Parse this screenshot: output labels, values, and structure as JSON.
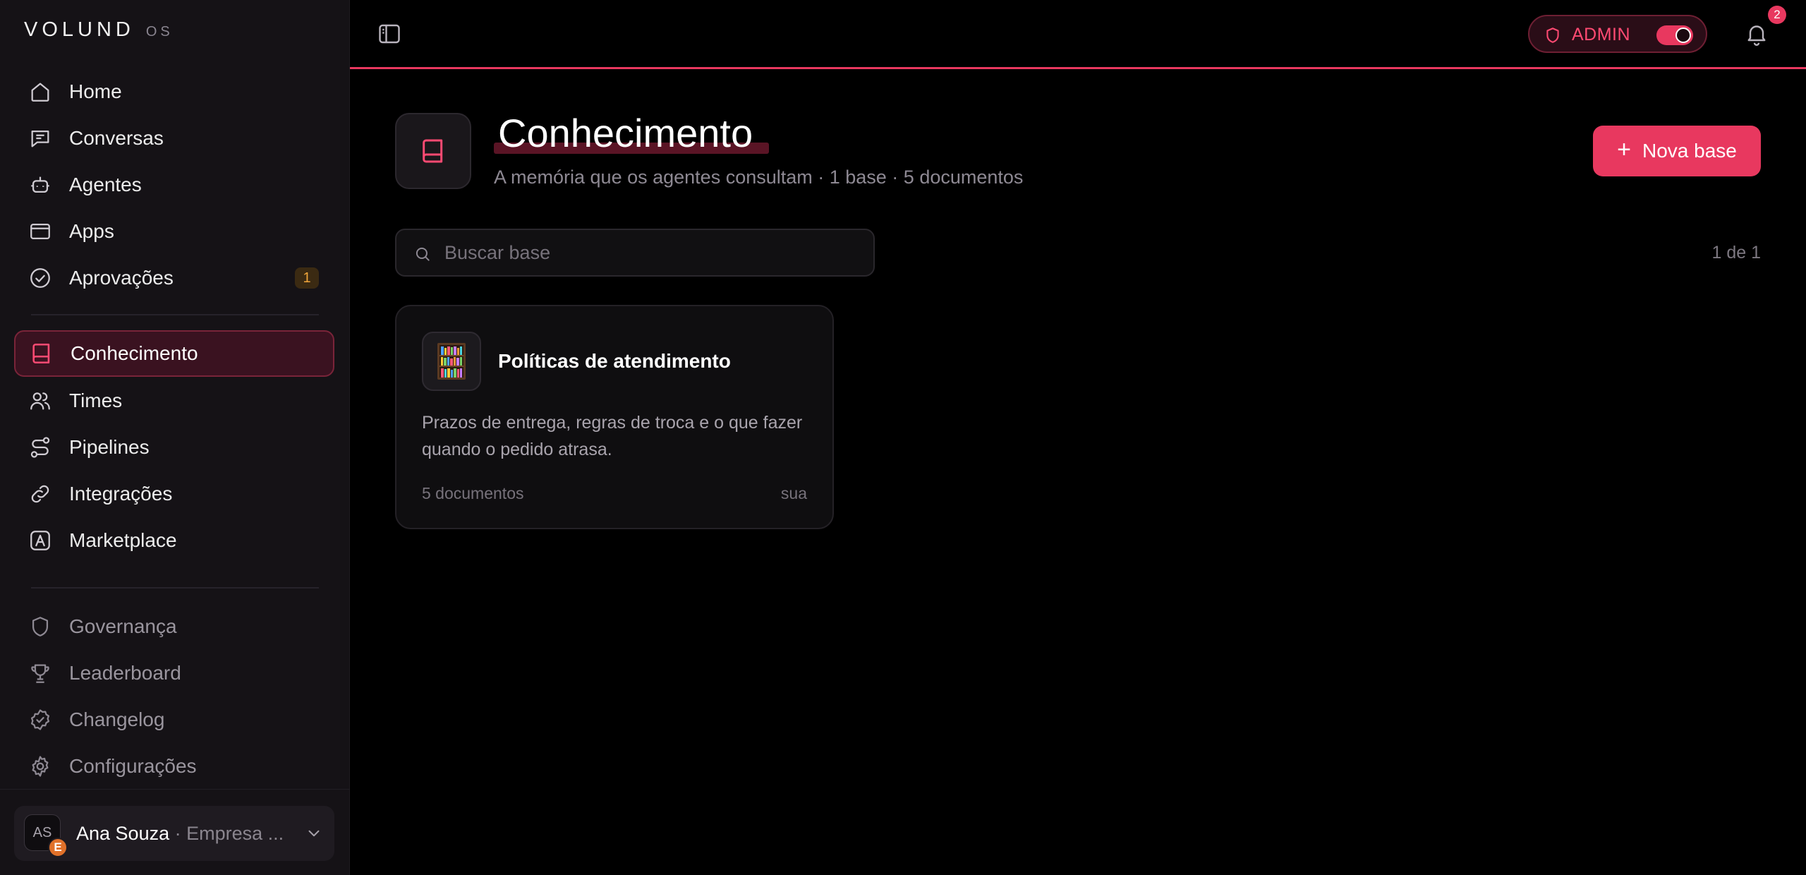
{
  "app": {
    "logo_main": "VOLUND",
    "logo_suffix": "OS"
  },
  "sidebar": {
    "items": [
      {
        "label": "Home",
        "icon": "home-icon"
      },
      {
        "label": "Conversas",
        "icon": "chat-icon"
      },
      {
        "label": "Agentes",
        "icon": "bot-icon"
      },
      {
        "label": "Apps",
        "icon": "app-window-icon"
      },
      {
        "label": "Aprovações",
        "icon": "check-circle-icon",
        "badge": "1"
      },
      {
        "label": "Conhecimento",
        "icon": "book-icon",
        "active": true
      },
      {
        "label": "Times",
        "icon": "users-icon"
      },
      {
        "label": "Pipelines",
        "icon": "route-icon"
      },
      {
        "label": "Integrações",
        "icon": "link-icon"
      },
      {
        "label": "Marketplace",
        "icon": "store-icon"
      },
      {
        "label": "Governança",
        "icon": "shield-icon"
      },
      {
        "label": "Leaderboard",
        "icon": "trophy-icon"
      },
      {
        "label": "Changelog",
        "icon": "badge-check-icon"
      },
      {
        "label": "Configurações",
        "icon": "gear-icon"
      }
    ]
  },
  "user": {
    "initials": "AS",
    "org_initial": "E",
    "name": "Ana Souza",
    "separator": "·",
    "org": "Empresa ..."
  },
  "topbar": {
    "admin_label": "ADMIN",
    "admin_enabled": true,
    "notifications_count": "2"
  },
  "page": {
    "title": "Conhecimento",
    "subtitle": "A memória que os agentes consultam · 1 base · 5 documentos",
    "new_button_label": "Nova base",
    "search_placeholder": "Buscar base",
    "pagination": "1 de 1"
  },
  "bases": [
    {
      "title": "Políticas de atendimento",
      "description": "Prazos de entrega, regras de troca e o que fazer quando o pedido atrasa.",
      "documents": "5 documentos",
      "owner": "sua",
      "icon": "bookshelf-icon"
    }
  ],
  "colors": {
    "accent": "#e8385f",
    "sidebar_bg": "#151216",
    "badge_amber": "#f0a53b"
  }
}
